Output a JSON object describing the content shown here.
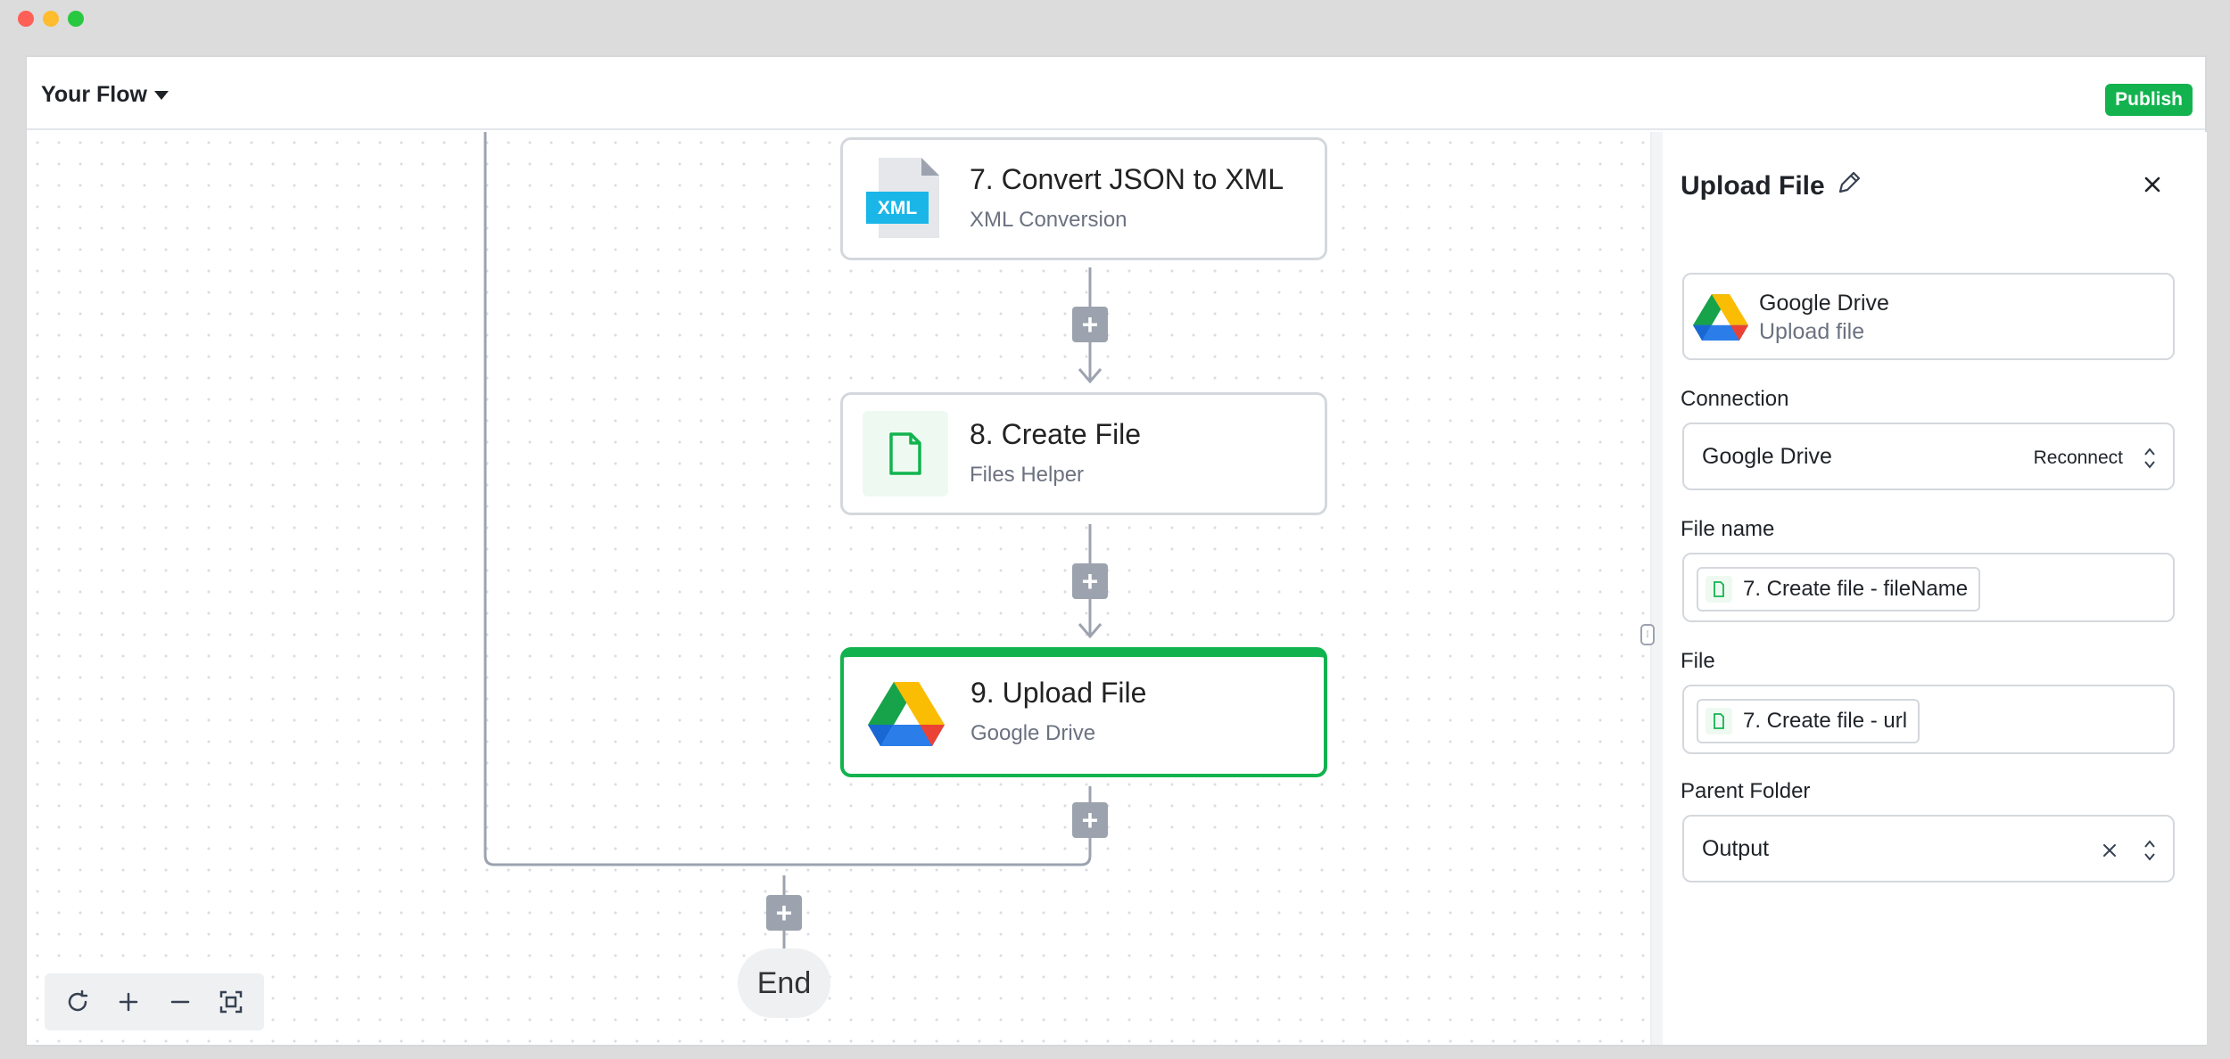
{
  "window": {
    "title": "Your Flow",
    "publish_label": "Publish"
  },
  "nodes": [
    {
      "title": "7. Convert JSON to XML",
      "subtitle": "XML Conversion",
      "icon": "xml-file-icon",
      "icon_text": "XML"
    },
    {
      "title": "8. Create File",
      "subtitle": "Files Helper",
      "icon": "file-icon"
    },
    {
      "title": "9. Upload File",
      "subtitle": "Google Drive",
      "icon": "google-drive-icon"
    }
  ],
  "end_label": "End",
  "zoom_controls": [
    "refresh-icon",
    "zoom-in-icon",
    "zoom-out-icon",
    "fit-screen-icon"
  ],
  "panel": {
    "title": "Upload File",
    "app": {
      "name": "Google Drive",
      "action": "Upload file"
    },
    "connection": {
      "label": "Connection",
      "value": "Google Drive",
      "reconnect": "Reconnect"
    },
    "file_name": {
      "label": "File name",
      "value": "7. Create file - fileName"
    },
    "file": {
      "label": "File",
      "value": "7. Create file - url"
    },
    "parent_folder": {
      "label": "Parent Folder",
      "value": "Output"
    }
  },
  "colors": {
    "accent": "#12b34f",
    "connector": "#9ca3af",
    "xml_badge": "#1ab6e8"
  }
}
